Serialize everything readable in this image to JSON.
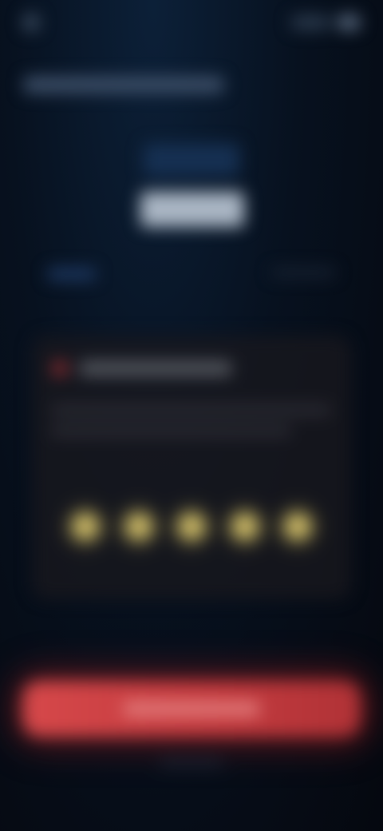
{
  "screen": {
    "state": "blurred"
  },
  "colors": {
    "background": "#07111f",
    "accent": "#d6484a",
    "star": "#c9b765",
    "card": "#19181e"
  },
  "icons": {
    "app": "app-dot-icon",
    "alert": "alert-icon",
    "star": "star-icon"
  },
  "rating": {
    "max": 5
  }
}
